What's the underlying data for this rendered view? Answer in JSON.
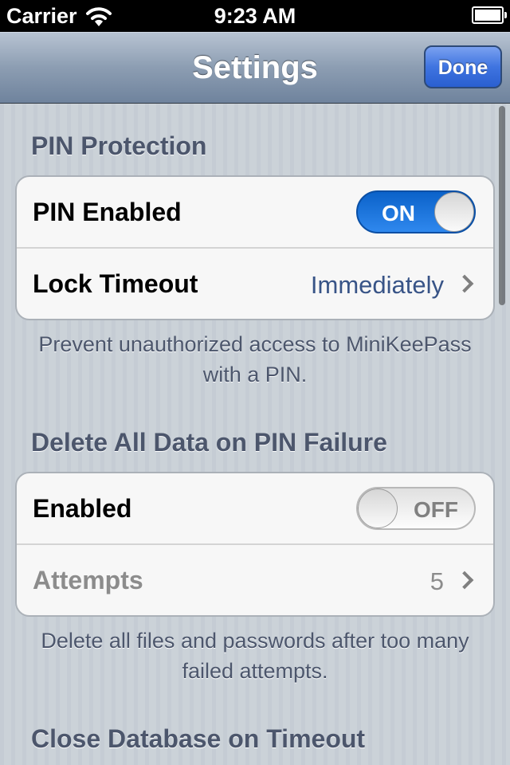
{
  "status_bar": {
    "carrier": "Carrier",
    "time": "9:23 AM"
  },
  "nav": {
    "title": "Settings",
    "done_label": "Done"
  },
  "sections": [
    {
      "header": "PIN Protection",
      "rows": [
        {
          "label": "PIN Enabled",
          "switch": "ON"
        },
        {
          "label": "Lock Timeout",
          "value": "Immediately"
        }
      ],
      "footer": "Prevent unauthorized access to MiniKeePass with a PIN."
    },
    {
      "header": "Delete All Data on PIN Failure",
      "rows": [
        {
          "label": "Enabled",
          "switch": "OFF"
        },
        {
          "label": "Attempts",
          "value": "5"
        }
      ],
      "footer": "Delete all files and passwords after too many failed attempts."
    },
    {
      "header": "Close Database on Timeout"
    }
  ],
  "colors": {
    "switch_on": "#1a75de",
    "done_button": "#3f74e0",
    "section_text": "#4c566c",
    "detail_value": "#385487"
  }
}
